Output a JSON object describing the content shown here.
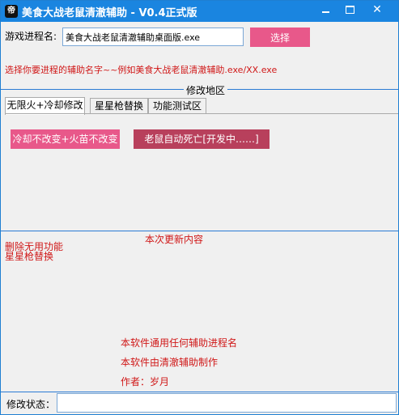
{
  "window": {
    "icon_glyph": "帝",
    "title": "美食大战老鼠清澈辅助 - V0.4正式版",
    "controls": {
      "minimize": "minimize-icon",
      "maximize": "maximize-icon",
      "close": "close-icon"
    }
  },
  "process": {
    "label": "游戏进程名:",
    "value": "美食大战老鼠清澈辅助桌面版.exe",
    "select_label": "选择"
  },
  "hint": "选择你要进程的辅助名字~~例如美食大战老鼠清澈辅助.exe/XX.exe",
  "modify_group": {
    "title": "修改地区",
    "tabs": [
      {
        "label": "无限火+冷却修改",
        "active": true
      },
      {
        "label": "星星枪替换",
        "active": false
      },
      {
        "label": "功能测试区",
        "active": false
      }
    ],
    "buttons": {
      "cooldown": "冷却不改变+火苗不改变",
      "mouse_death": "老鼠自动死亡[开发中……]"
    }
  },
  "update": {
    "title": "本次更新内容",
    "items": [
      "删除无用功能",
      "星星枪替换"
    ]
  },
  "info": {
    "line1": "本软件通用任何辅助进程名",
    "line2": "本软件由清澈辅助制作",
    "line3": "作者：岁月"
  },
  "status": {
    "label": "修改状态：",
    "value": ""
  },
  "colors": {
    "titlebar": "#1a85e0",
    "accent_button": "#e8588a",
    "dark_button": "#b8405c",
    "red_text": "#d01818",
    "group_line": "#2a7bd4"
  }
}
